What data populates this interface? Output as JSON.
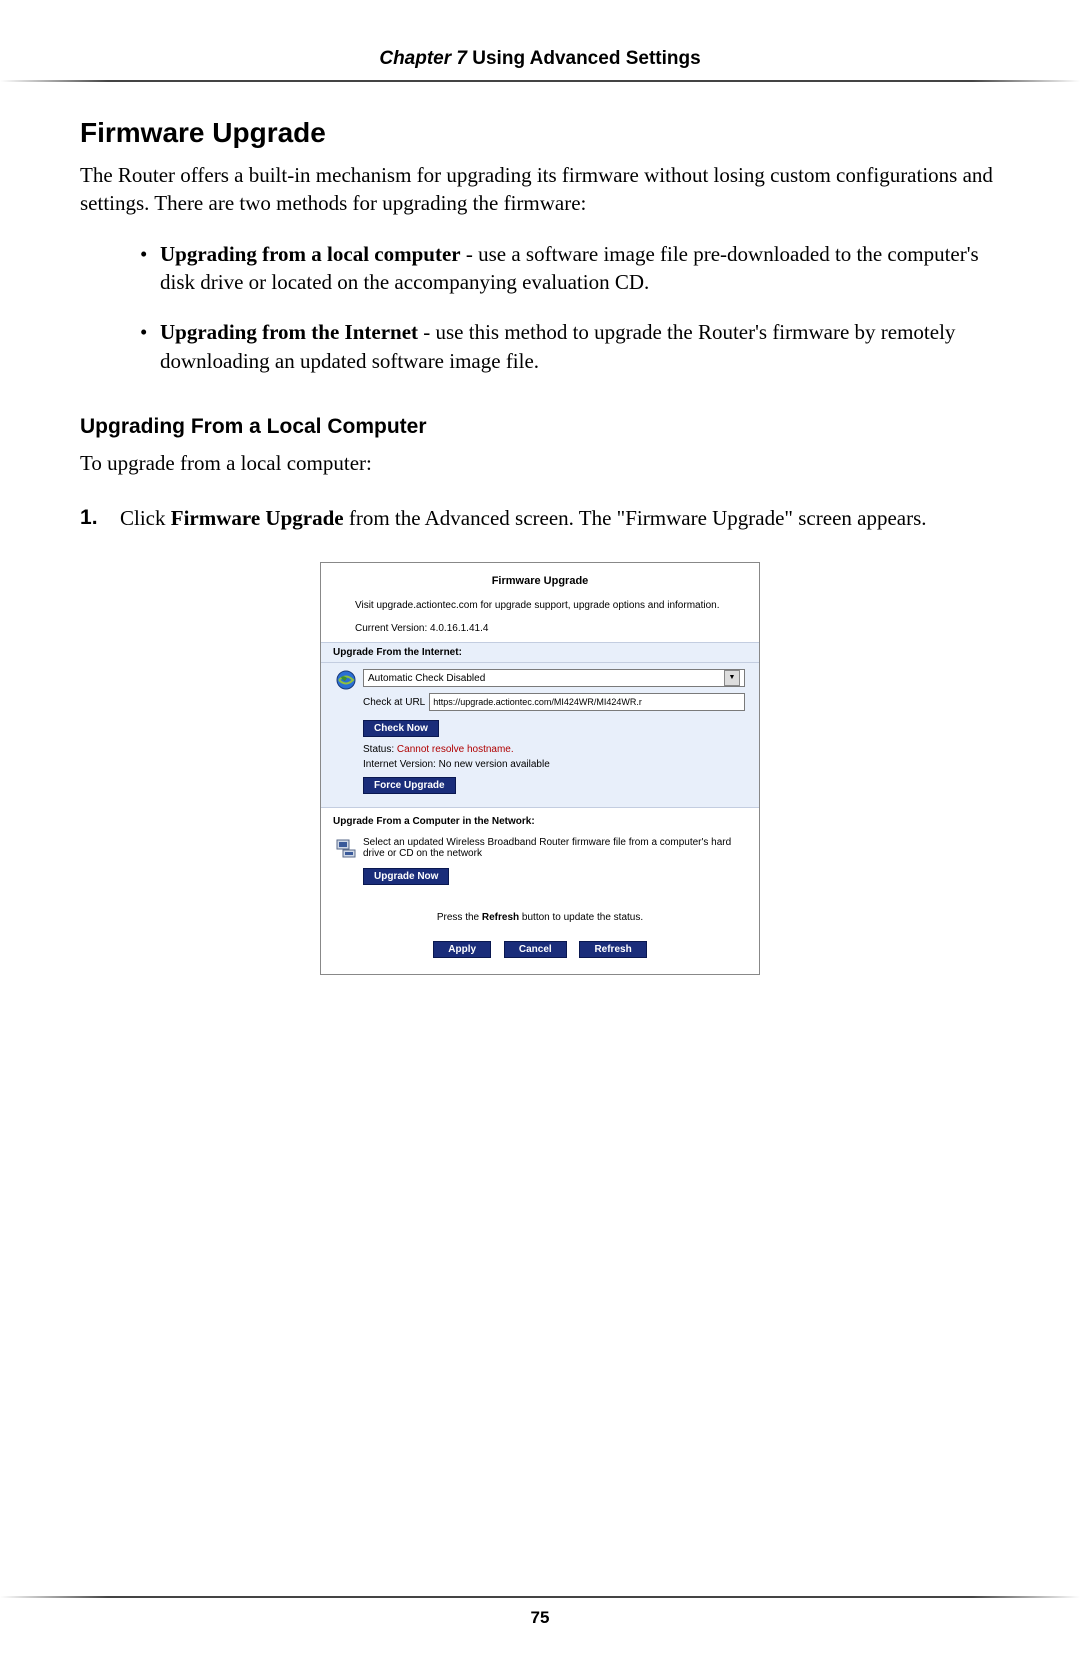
{
  "header": {
    "chapter_prefix": "Chapter 7",
    "chapter_title": "Using Advanced Settings"
  },
  "section": {
    "title": "Firmware Upgrade",
    "intro": "The Router offers a built-in mechanism for upgrading its firmware without losing custom configurations and settings. There are two methods for upgrading the firmware:",
    "methods": [
      {
        "bold": "Upgrading from a local computer",
        "rest": " - use a software image file pre-downloaded to the computer's disk drive or located on the accompanying evaluation CD."
      },
      {
        "bold": "Upgrading from the Internet",
        "rest": " - use this method to upgrade the Router's firmware by remotely downloading an updated software image file."
      }
    ],
    "subheading": "Upgrading From a Local Computer",
    "sub_intro": "To upgrade from a local computer:",
    "step1_pre": "Click ",
    "step1_bold": "Firmware Upgrade",
    "step1_post": " from the Advanced screen. The \"Firmware Upgrade\" screen appears."
  },
  "screenshot": {
    "title": "Firmware Upgrade",
    "visit_text": "Visit upgrade.actiontec.com for upgrade support, upgrade options and information.",
    "version_label": "Current Version: 4.0.16.1.41.4",
    "internet_header": "Upgrade From the Internet:",
    "select_value": "Automatic Check Disabled",
    "url_label": "Check at URL",
    "url_value": "https://upgrade.actiontec.com/MI424WR/MI424WR.r",
    "check_now": "Check Now",
    "status_label": "Status: ",
    "status_value": "Cannot resolve hostname.",
    "internet_version": "Internet Version: No new version available",
    "force_upgrade": "Force Upgrade",
    "network_header": "Upgrade From a Computer in the Network:",
    "network_text": "Select an updated Wireless Broadband Router firmware file from a computer's hard drive or CD on the network",
    "upgrade_now": "Upgrade Now",
    "refresh_pre": "Press the ",
    "refresh_bold": "Refresh",
    "refresh_post": " button to update the status.",
    "apply": "Apply",
    "cancel": "Cancel",
    "refresh": "Refresh"
  },
  "page_number": "75"
}
